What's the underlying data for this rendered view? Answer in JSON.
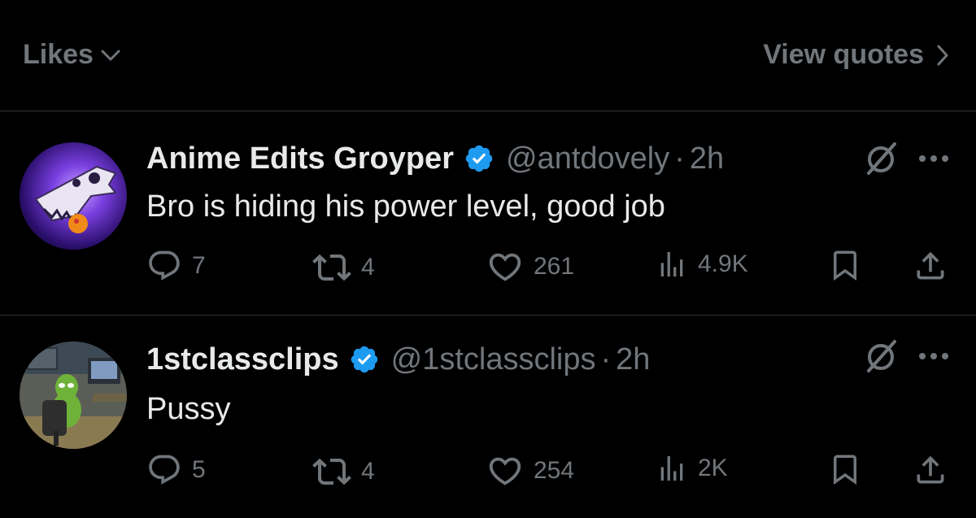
{
  "header": {
    "likes_label": "Likes",
    "view_quotes_label": "View quotes"
  },
  "tweets": [
    {
      "display_name": "Anime Edits Groyper",
      "handle": "@antdovely",
      "separator": "·",
      "time": "2h",
      "text": "Bro is hiding his power level, good job",
      "replies": "7",
      "reposts": "4",
      "likes": "261",
      "views": "4.9K",
      "verified": true
    },
    {
      "display_name": "1stclassclips",
      "handle": "@1stclassclips",
      "separator": "·",
      "time": "2h",
      "text": "Pussy",
      "replies": "5",
      "reposts": "4",
      "likes": "254",
      "views": "2K",
      "verified": true
    }
  ],
  "colors": {
    "background": "#000000",
    "text_primary": "#e7e9ea",
    "text_secondary": "#71767b",
    "verified_blue": "#1d9bf0",
    "divider": "#2f3336"
  }
}
